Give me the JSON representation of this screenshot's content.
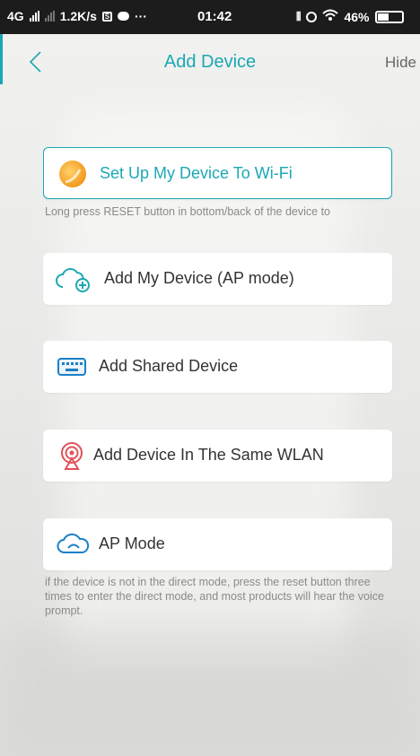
{
  "status_bar": {
    "network": "4G",
    "speed": "1.2K/s",
    "more": "···",
    "time": "01:42",
    "battery": "46%"
  },
  "header": {
    "title": "Add Device",
    "hide_label": "Hide"
  },
  "options": [
    {
      "label": "Set Up My Device To Wi-Fi",
      "icon": "wifi-setup-icon",
      "highlighted": true
    },
    {
      "label": "Add My Device (AP mode)",
      "icon": "cloud-plus-icon"
    },
    {
      "label": "Add Shared Device",
      "icon": "keyboard-icon"
    },
    {
      "label": "Add Device In The Same WLAN",
      "icon": "broadcast-icon"
    },
    {
      "label": "AP Mode",
      "icon": "cloud-link-icon"
    }
  ],
  "hints": {
    "wifi_setup": "Long press RESET button in bottom/back of the device to",
    "ap_mode": "if the device is not in the direct mode, press the reset button three times to enter the direct mode, and most products will hear the voice prompt."
  },
  "colors": {
    "accent": "#1ba8b4",
    "status_bar": "#1c1c1c"
  }
}
